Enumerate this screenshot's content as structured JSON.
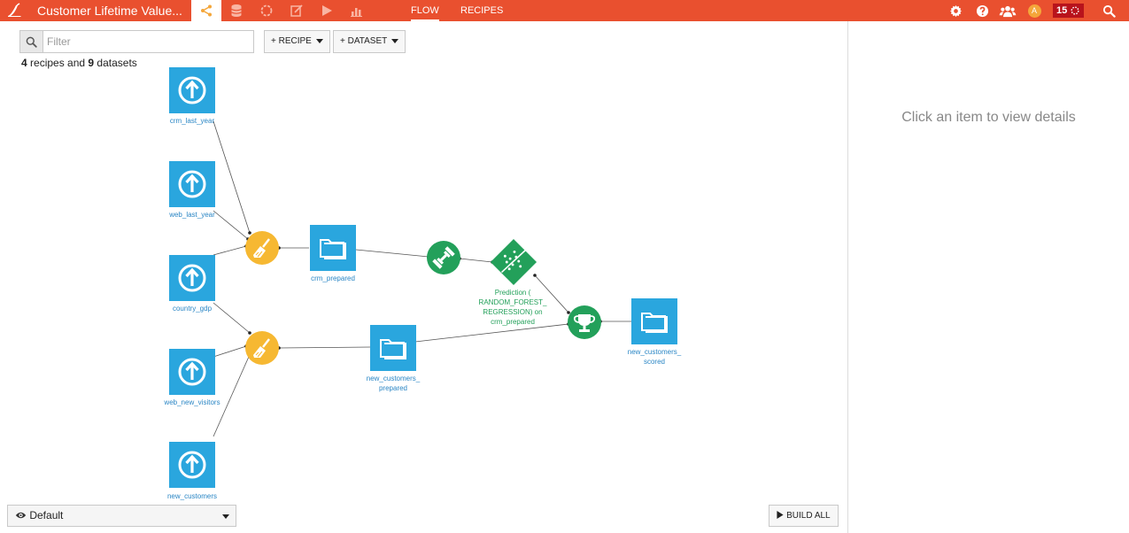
{
  "header": {
    "project_title": "Customer Lifetime Value...",
    "nav_links": [
      {
        "label": "FLOW"
      },
      {
        "label": "RECIPES"
      }
    ],
    "nav_icons": [
      "flow-icon",
      "datasets-icon",
      "models-icon",
      "notebooks-icon",
      "scenarios-icon",
      "dashboards-icon"
    ],
    "right_icons": [
      "gear-icon",
      "help-icon",
      "people-icon"
    ],
    "avatar_letter": "A",
    "notification_count": "15",
    "colors": {
      "bar": "#e9502f",
      "dataset": "#2aa6de",
      "prep_recipe": "#f6b832",
      "ml_recipe": "#23a05a"
    }
  },
  "toolbar": {
    "filter_placeholder": "Filter",
    "recipe_button": "+ RECIPE",
    "dataset_button": "+ DATASET",
    "summary": {
      "recipes_count": "4",
      "recipes_text": " recipes and ",
      "datasets_count": "9",
      "datasets_text": " datasets"
    }
  },
  "flow": {
    "datasets": [
      {
        "name": "crm_last_year",
        "type": "uploaded"
      },
      {
        "name": "web_last_year",
        "type": "uploaded"
      },
      {
        "name": "country_gdp",
        "type": "uploaded"
      },
      {
        "name": "web_new_visitors",
        "type": "uploaded"
      },
      {
        "name": "new_customers",
        "type": "uploaded"
      },
      {
        "name": "crm_prepared",
        "type": "managed"
      },
      {
        "name": [
          "new_customers_",
          "prepared"
        ],
        "type": "managed"
      },
      {
        "name": [
          "new_customers_",
          "scored"
        ],
        "type": "managed"
      }
    ],
    "recipes": [
      {
        "type": "prepare"
      },
      {
        "type": "prepare"
      },
      {
        "type": "train"
      },
      {
        "type": "score"
      }
    ],
    "model_label": [
      "Prediction (",
      "RANDOM_FOREST_",
      "REGRESSION) on",
      "crm_prepared"
    ]
  },
  "details_panel": {
    "placeholder": "Click an item to view details"
  },
  "footer": {
    "view_label": "Default",
    "build_all_label": "BUILD ALL"
  }
}
